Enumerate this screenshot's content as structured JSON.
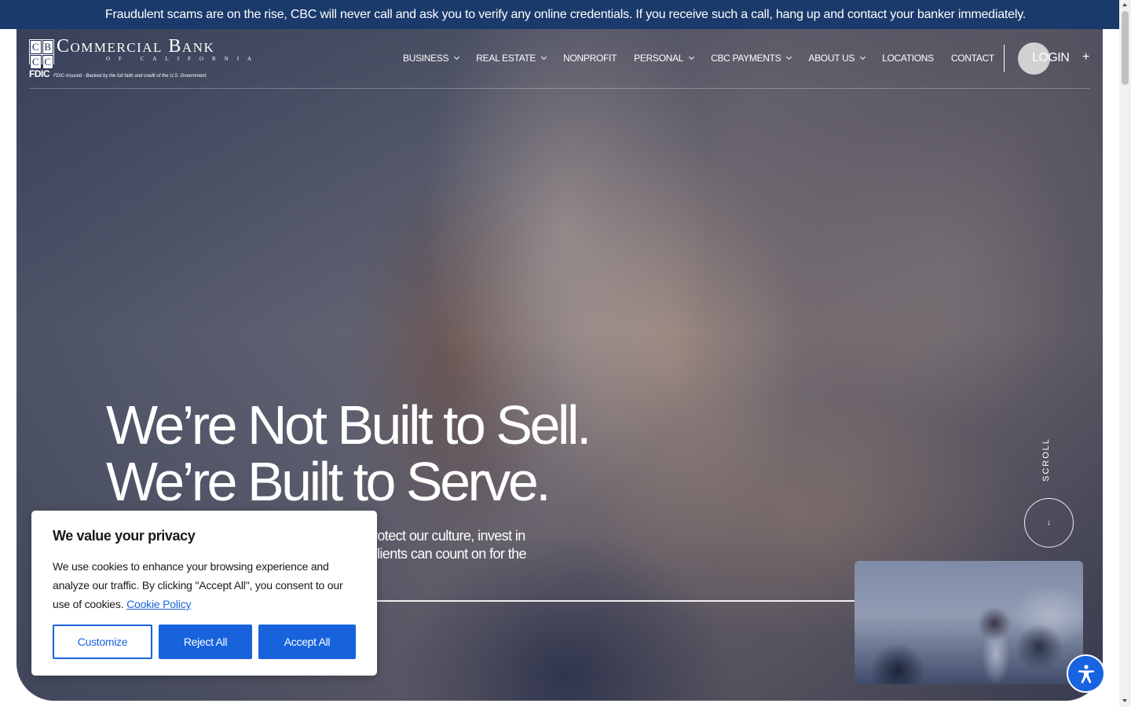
{
  "alert": {
    "text": "Fraudulent scams are on the rise, CBC will never call and ask you to verify any online credentials. If you receive such a call, hang up and contact your banker immediately."
  },
  "logo": {
    "mark_letters": [
      "C",
      "B",
      "C",
      "C"
    ],
    "name": "Commercial Bank",
    "subname": "of California",
    "fdic_mark": "FDIC",
    "fdic_text": "FDIC-Insured - Backed by the full faith and credit of the U.S. Government"
  },
  "nav": {
    "items": [
      {
        "label": "BUSINESS",
        "has_dropdown": true
      },
      {
        "label": "REAL ESTATE",
        "has_dropdown": true
      },
      {
        "label": "NONPROFIT",
        "has_dropdown": false
      },
      {
        "label": "PERSONAL",
        "has_dropdown": true
      },
      {
        "label": "CBC PAYMENTS",
        "has_dropdown": true
      },
      {
        "label": "ABOUT US",
        "has_dropdown": true
      },
      {
        "label": "LOCATIONS",
        "has_dropdown": false
      },
      {
        "label": "CONTACT",
        "has_dropdown": false
      }
    ],
    "login_label": "LOGIN",
    "plus_label": "+"
  },
  "hero": {
    "headline_line1": "We’re Not Built to Sell.",
    "headline_line2": "We’re Built to Serve.",
    "body_line1": "rotect our culture, invest in",
    "body_line2": "lients can count on for the",
    "scroll_label": "SCROLL",
    "scroll_arrow": "↓"
  },
  "cookie": {
    "title": "We value your privacy",
    "text": "We use cookies to enhance your browsing experience and analyze our traffic. By clicking \"Accept All\", you consent to our use of cookies.",
    "link": "Cookie Policy",
    "customize_label": "Customize",
    "reject_label": "Reject All",
    "accept_label": "Accept All"
  },
  "colors": {
    "alert_bg": "#1a3a6b",
    "primary_button": "#1863dc",
    "accessibility_button": "#1864e0"
  },
  "icons": {
    "accessibility": "accessibility-person-icon",
    "dropdown": "chevron-down-icon",
    "scroll": "arrow-down-icon"
  }
}
